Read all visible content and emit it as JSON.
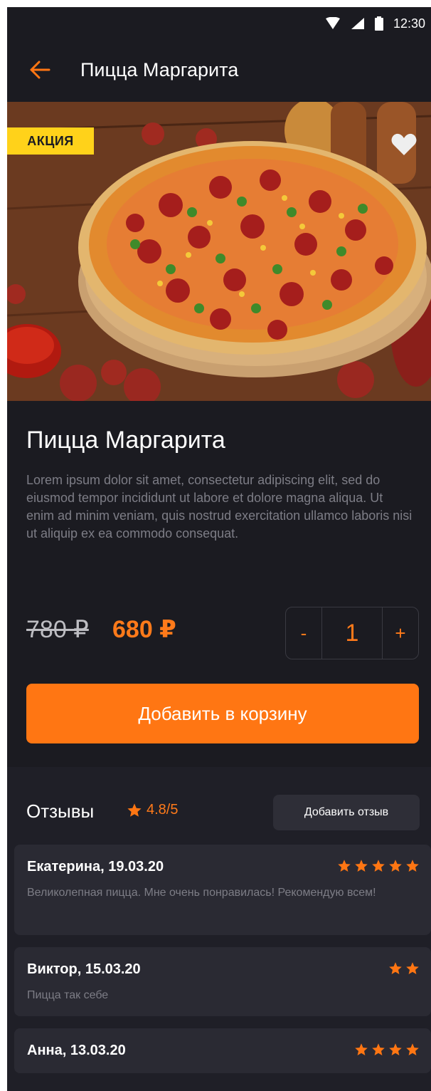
{
  "status_bar": {
    "time": "12:30"
  },
  "app_bar": {
    "title": "Пицца Маргарита"
  },
  "hero": {
    "badge": "АКЦИЯ"
  },
  "product": {
    "title": "Пицца Маргарита",
    "description": "Lorem ipsum dolor sit amet, consectetur adipiscing elit, sed do eiusmod tempor incididunt ut labore et dolore magna aliqua. Ut enim ad minim veniam, quis nostrud exercitation ullamco laboris nisi ut aliquip ex ea commodo consequat.",
    "old_price": "780 ₽",
    "new_price": "680 ₽",
    "quantity": "1",
    "minus_label": "-",
    "plus_label": "+",
    "add_to_cart_label": "Добавить в корзину"
  },
  "reviews": {
    "title": "Отзывы",
    "rating": "4.8/5",
    "add_review_label": "Добавить отзыв",
    "items": [
      {
        "author": "Екатерина, 19.03.20",
        "stars": 5,
        "text": "Великолепная пицца. Мне очень понравилась! Рекомендую всем!"
      },
      {
        "author": "Виктор, 15.03.20",
        "stars": 2,
        "text": "Пицца так себе"
      },
      {
        "author": "Анна, 13.03.20",
        "stars": 4,
        "text": ""
      }
    ]
  },
  "colors": {
    "accent": "#ff7613",
    "badge": "#ffd21a",
    "background": "#1b1b21"
  },
  "icons": [
    "wifi-icon",
    "signal-icon",
    "battery-icon",
    "back-arrow-icon",
    "heart-icon",
    "star-icon"
  ]
}
